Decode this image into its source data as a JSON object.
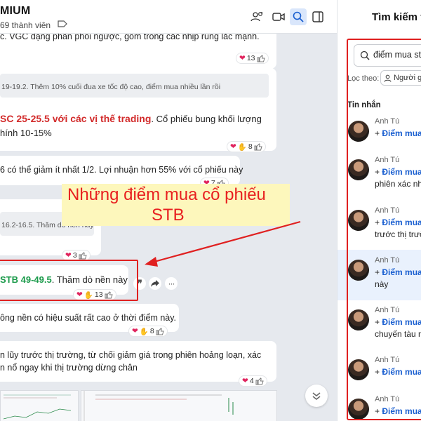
{
  "chat": {
    "title": "MIUM",
    "members": "69 thành viên",
    "messages": {
      "m1_text": "c. VGC dạng phân phối ngược, gồm trong các nhịp rung lắc mạnh.",
      "m1_react": "13",
      "m2_quote": "19-19.2. Thêm 10% cuối đua xe tốc độ cao, điểm mua nhiều lần rồi",
      "m2_red": "SC 25-25.5 với các vị thế trading",
      "m2_text": ". Cổ phiếu bung khối lượng",
      "m2_text2": "hính 10-15%",
      "m2_react": "8",
      "m3_text": "6 có thể giảm ít nhất 1/2. Lợi nhuận hơn 55% với cổ phiếu này",
      "m3_react": "7",
      "m4_quote": "16.2-16.5. Thăm dò nền này",
      "m4_react": "3",
      "m5_green": "STB 49-49.5",
      "m5_text": ". Thăm dò nền này",
      "m5_react": "13",
      "m6_text": "ông nền có hiệu suất rất cao ở thời điểm này.",
      "m6_react": "8",
      "m7_text": "n lũy trước thị trường, từ chối giảm giá trong phiên hoảng loạn, xác",
      "m7_text2": "n nổ ngay khi thị trường dừng chân",
      "m7_react": "4"
    },
    "annotation": {
      "line1": "Những điểm mua cổ phiếu",
      "line2": "STB"
    }
  },
  "panel": {
    "title": "Tìm kiếm t",
    "search_value": "điểm mua stb",
    "filter_label": "Lọc theo:",
    "filter_chip": "Người g",
    "section_label": "Tin nhắn",
    "results": [
      {
        "name": "Anh Tú",
        "prefix": "+ ",
        "hl": "Điểm mua",
        "line2": ""
      },
      {
        "name": "Anh Tú",
        "prefix": "+ ",
        "hl": "Điểm mua",
        "line2": "phiên xác nhậ"
      },
      {
        "name": "Anh Tú",
        "prefix": "+ ",
        "hl": "Điểm mua",
        "line2": "trước thị trườ"
      },
      {
        "name": "Anh Tú",
        "prefix": "+ ",
        "hl": "Điểm mua",
        "line2": "này"
      },
      {
        "name": "Anh Tú",
        "prefix": "+ ",
        "hl": "Điểm mua",
        "line2": "chuyến tàu n"
      },
      {
        "name": "Anh Tú",
        "prefix": "+ ",
        "hl": "Điểm mua",
        "line2": ""
      },
      {
        "name": "Anh Tú",
        "prefix": "+ ",
        "hl": "Điểm mua",
        "line2": ""
      }
    ]
  },
  "colors": {
    "accent": "#1a5fd0",
    "highlight_red": "#e02020",
    "annotation_bg": "#fdf7bc",
    "trading_red": "#d22a2a",
    "stb_green": "#1a9a4a"
  },
  "icons": [
    "tag-icon",
    "add-member-icon",
    "video-call-icon",
    "search-icon",
    "sidebar-toggle-icon",
    "heart-icon",
    "thumbs-up-icon",
    "clap-icon",
    "quote-icon",
    "share-icon",
    "more-icon",
    "chevron-down-icon",
    "user-icon"
  ]
}
